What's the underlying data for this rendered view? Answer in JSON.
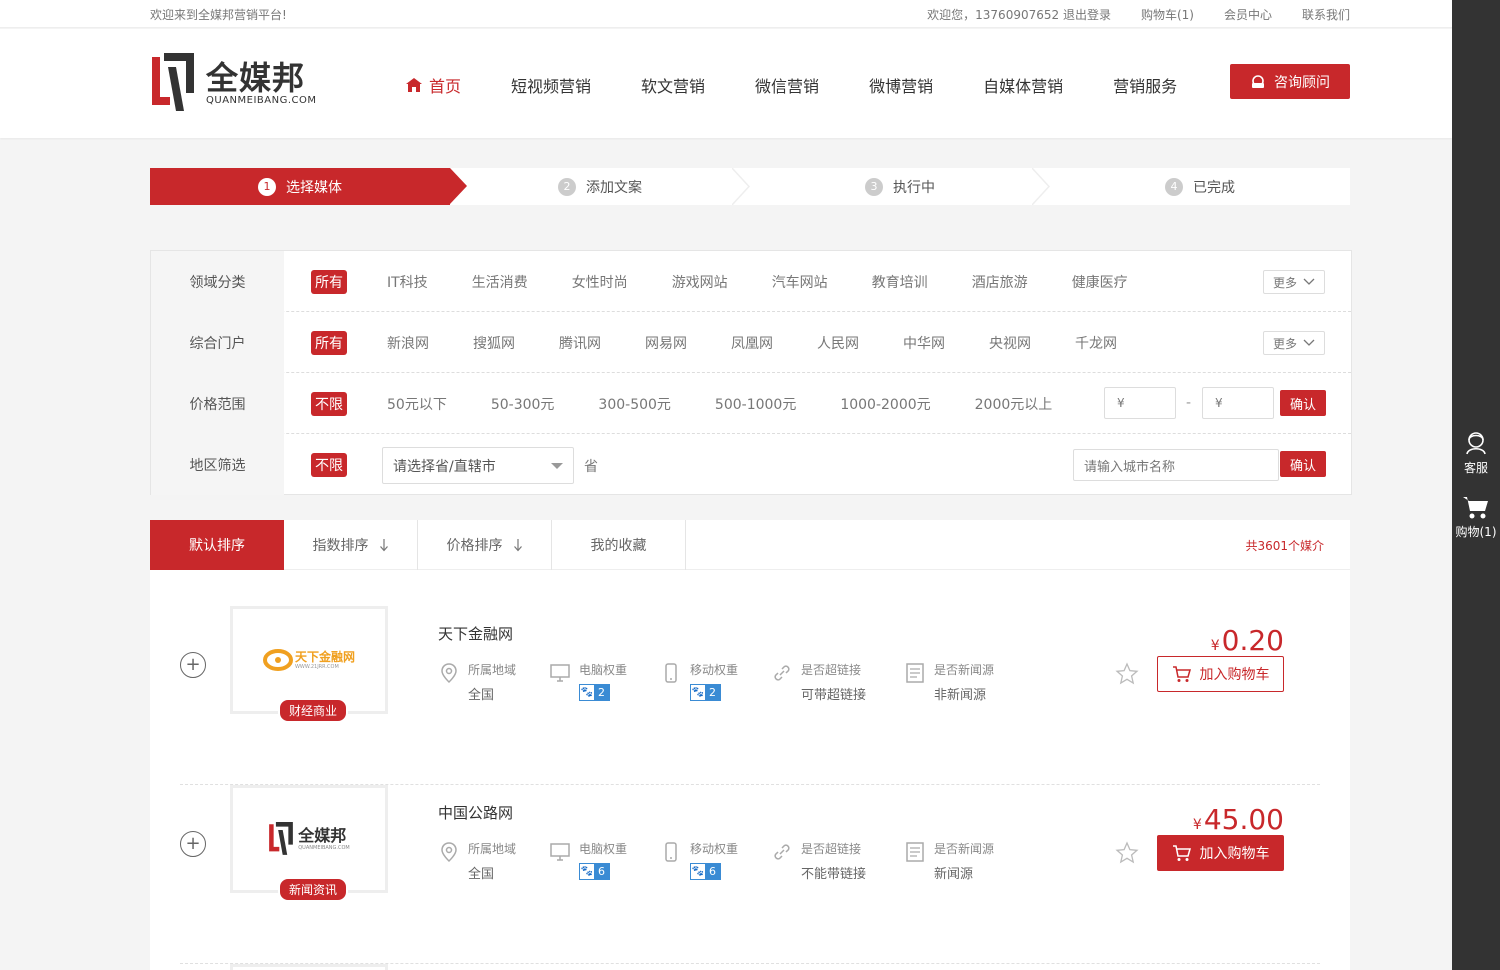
{
  "topbar": {
    "welcome": "欢迎来到全媒邦营销平台!",
    "user": "欢迎您，13760907652 退出登录",
    "cart": "购物车(1)",
    "member": "会员中心",
    "contact": "联系我们"
  },
  "header": {
    "logo_cn": "全媒邦",
    "logo_en": "QUANMEIBANG.COM",
    "nav": [
      "首页",
      "短视频营销",
      "软文营销",
      "微信营销",
      "微博营销",
      "自媒体营销",
      "营销服务"
    ],
    "consult": "咨询顾问"
  },
  "steps": [
    {
      "num": "1",
      "label": "选择媒体"
    },
    {
      "num": "2",
      "label": "添加文案"
    },
    {
      "num": "3",
      "label": "执行中"
    },
    {
      "num": "4",
      "label": "已完成"
    }
  ],
  "filter": {
    "domain": {
      "label": "领域分类",
      "selected": "所有",
      "options": [
        "IT科技",
        "生活消费",
        "女性时尚",
        "游戏网站",
        "汽车网站",
        "教育培训",
        "酒店旅游",
        "健康医疗"
      ],
      "more": "更多"
    },
    "portal": {
      "label": "综合门户",
      "selected": "所有",
      "options": [
        "新浪网",
        "搜狐网",
        "腾讯网",
        "网易网",
        "凤凰网",
        "人民网",
        "中华网",
        "央视网",
        "千龙网"
      ],
      "more": "更多"
    },
    "price": {
      "label": "价格范围",
      "selected": "不限",
      "options": [
        "50元以下",
        "50-300元",
        "300-500元",
        "500-1000元",
        "1000-2000元",
        "2000元以上"
      ],
      "min_placeholder": "¥",
      "dash": "-",
      "max_placeholder": "¥",
      "confirm": "确认"
    },
    "region": {
      "label": "地区筛选",
      "selected": "不限",
      "province_placeholder": "请选择省/直辖市",
      "province_suffix": "省",
      "city_placeholder": "请输入城市名称",
      "confirm": "确认"
    }
  },
  "sort": {
    "default": "默认排序",
    "index": "指数排序",
    "price": "价格排序",
    "favorites": "我的收藏",
    "total": "共3601个媒介"
  },
  "items": [
    {
      "name": "天下金融网",
      "category": "财经商业",
      "logo_text": "天下金融网",
      "logo_sub": "WWW.21JRR.COM",
      "region_label": "所属地域",
      "region": "全国",
      "pc_label": "电脑权重",
      "pc_weight": "2",
      "mobile_label": "移动权重",
      "mobile_weight": "2",
      "link_label": "是否超链接",
      "link": "可带超链接",
      "news_label": "是否新闻源",
      "news": "非新闻源",
      "currency": "¥",
      "price": "0.20",
      "cart": "加入购物车"
    },
    {
      "name": "中国公路网",
      "category": "新闻资讯",
      "logo_text": "全媒邦",
      "logo_sub": "QUANMEIBANG.COM",
      "region_label": "所属地域",
      "region": "全国",
      "pc_label": "电脑权重",
      "pc_weight": "6",
      "mobile_label": "移动权重",
      "mobile_weight": "6",
      "link_label": "是否超链接",
      "link": "不能带链接",
      "news_label": "是否新闻源",
      "news": "新闻源",
      "currency": "¥",
      "price": "45.00",
      "cart": "加入购物车"
    }
  ],
  "sidebar": {
    "service": "客服",
    "cart": "购物(1)"
  },
  "colors": {
    "brand": "#c8282b",
    "weight_blue": "#3a8bd4"
  }
}
